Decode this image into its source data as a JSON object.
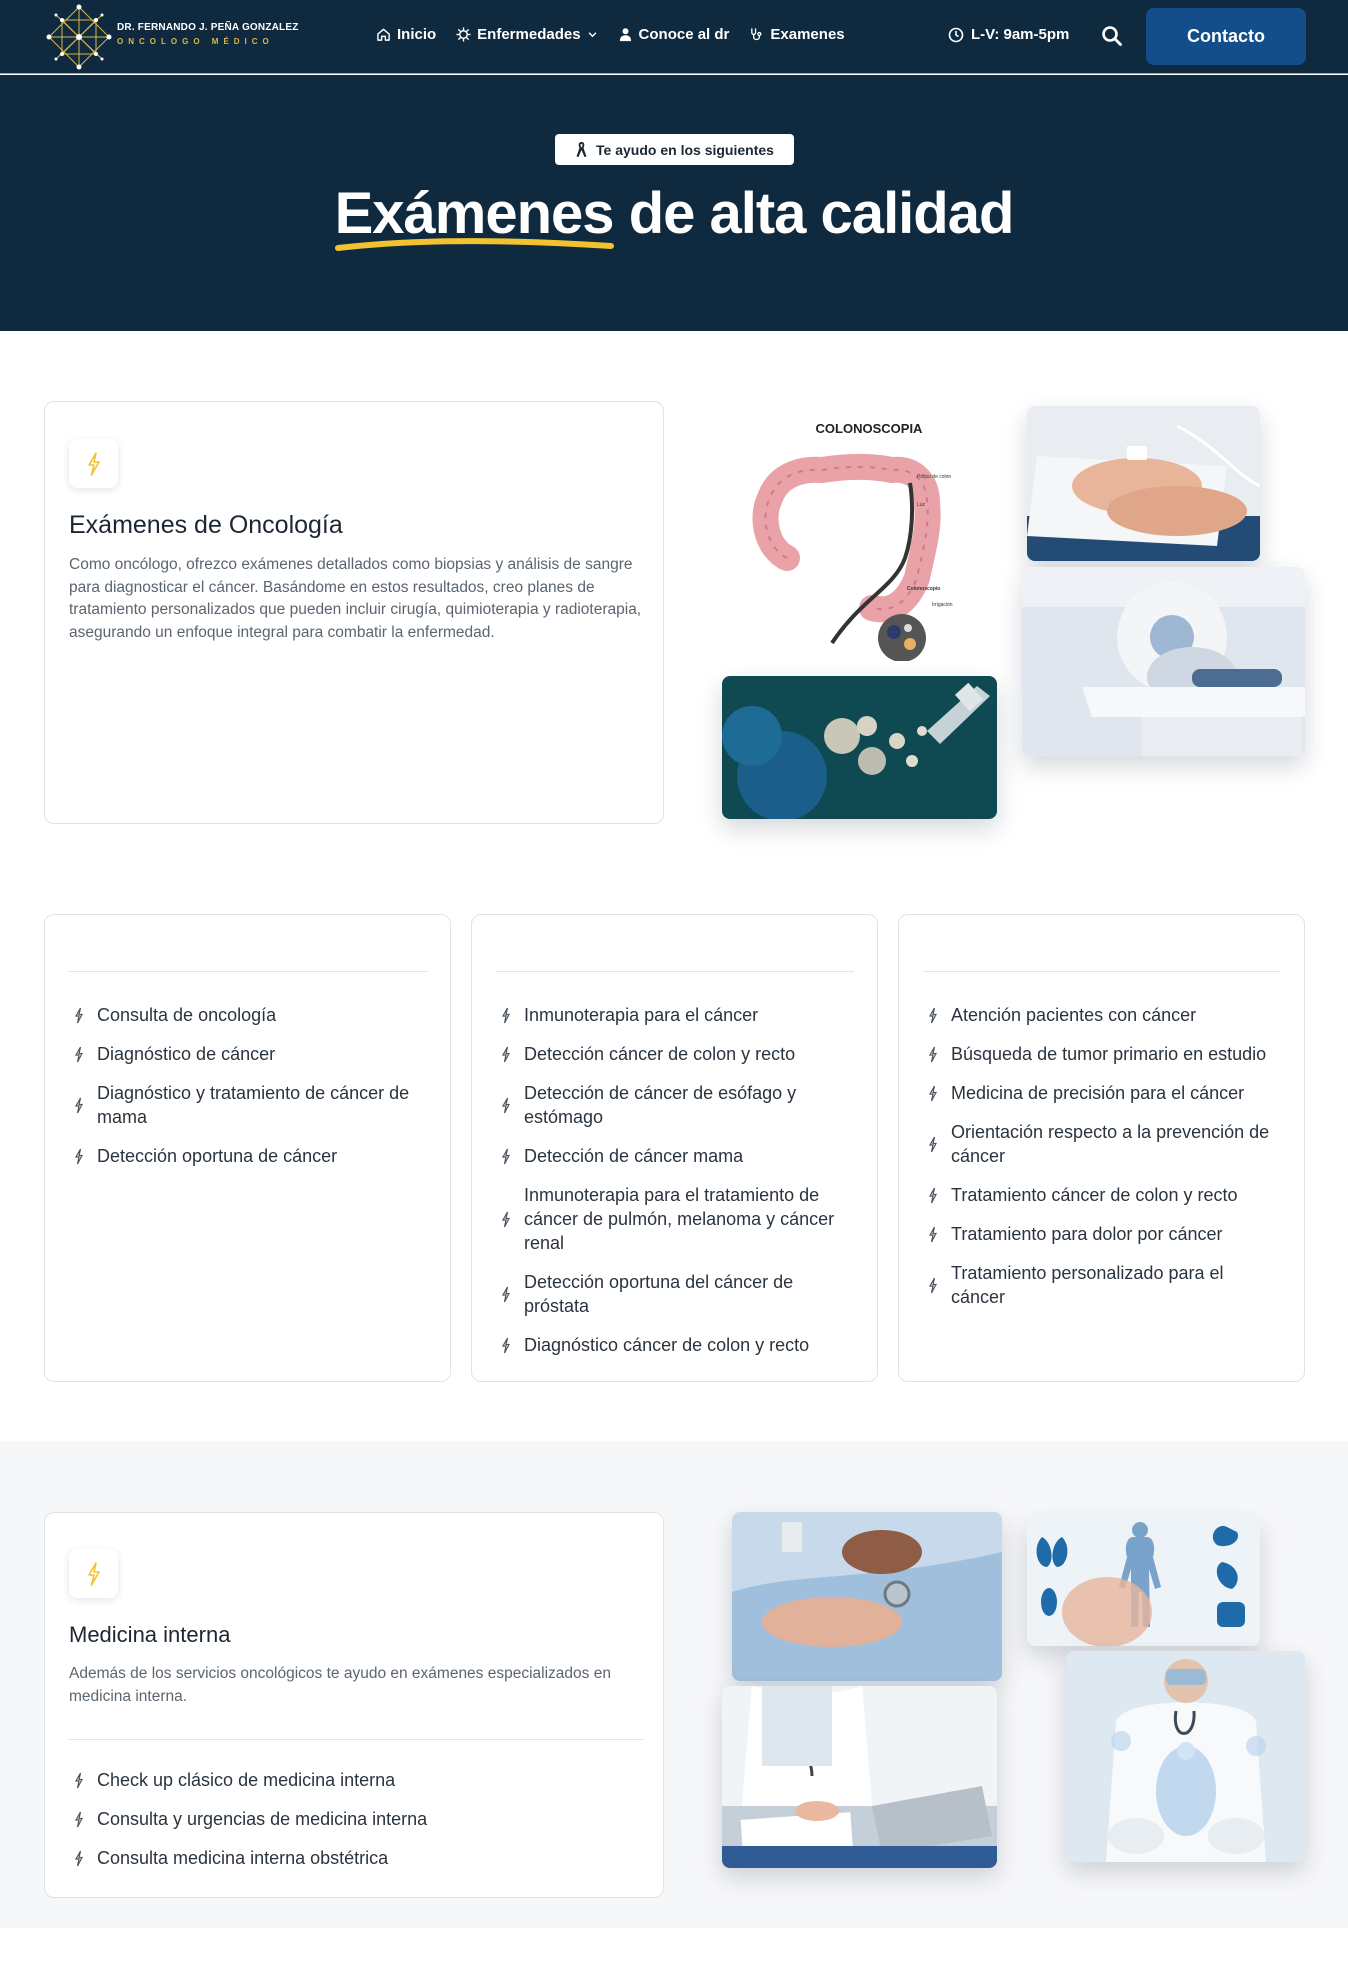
{
  "header": {
    "logo_name": "DR. FERNANDO J. PEÑA GONZALEZ",
    "logo_subtitle": "ONCOLOGO MÉDICO",
    "nav": [
      {
        "label": "Inicio",
        "icon": "home-icon"
      },
      {
        "label": "Enfermedades",
        "icon": "virus-icon"
      },
      {
        "label": "Conoce al dr",
        "icon": "doctor-icon"
      },
      {
        "label": "Examenes",
        "icon": "stethoscope-icon"
      }
    ],
    "hours": "L-V: 9am-5pm",
    "contact_label": "Contacto"
  },
  "hero": {
    "badge": "Te ayudo en los siguientes",
    "title_highlight": "Exámenes",
    "title_rest": " de alta calidad"
  },
  "oncology": {
    "title": "Exámenes de Oncología",
    "description": "Como oncólogo, ofrezco exámenes detallados como biopsias y análisis de sangre para diagnosticar el cáncer. Basándome en estos resultados, creo planes de tratamiento personalizados que pueden incluir cirugía, quimioterapia y radioterapia, asegurando un enfoque integral para combatir la enfermedad.",
    "image_caption": "COLONOSCOPIA"
  },
  "services": {
    "column1": [
      "Consulta de oncología",
      "Diagnóstico de cáncer",
      "Diagnóstico y tratamiento de cáncer de mama",
      "Detección oportuna de cáncer"
    ],
    "column2": [
      "Inmunoterapia para el cáncer",
      "Detección cáncer de colon y recto",
      "Detección de cáncer de esófago y estómago",
      "Detección de cáncer mama",
      "Inmunoterapia para el tratamiento de cáncer de pulmón, melanoma y cáncer renal",
      "Detección oportuna del cáncer de próstata",
      "Diagnóstico cáncer de colon y recto"
    ],
    "column3": [
      "Atención pacientes con cáncer",
      "Búsqueda de tumor primario en estudio",
      "Medicina de precisión para el cáncer",
      "Orientación respecto a la prevención de cáncer",
      "Tratamiento cáncer de colon y recto",
      "Tratamiento para dolor por cáncer",
      "Tratamiento personalizado para el cáncer"
    ]
  },
  "internal": {
    "title": "Medicina interna",
    "description": "Además de los servicios oncológicos te ayudo en exámenes especializados en medicina interna.",
    "items": [
      "Check up clásico de medicina interna",
      "Consulta y urgencias de medicina interna",
      "Consulta medicina interna obstétrica"
    ]
  },
  "colors": {
    "navy": "#0f2a3f",
    "button_blue": "#144e8a",
    "accent_yellow": "#f2c230"
  }
}
